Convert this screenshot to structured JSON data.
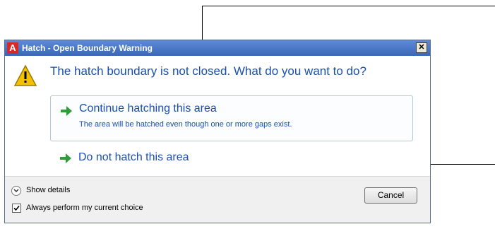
{
  "dialog": {
    "title": "Hatch - Open Boundary Warning",
    "app_icon_letter": "A",
    "close_glyph": "✕",
    "main_instruction": "The hatch boundary is not closed. What do you want to do?",
    "icons": {
      "warning": "warning-triangle-icon",
      "arrow": "green-arrow-icon"
    }
  },
  "choices": [
    {
      "label": "Continue hatching this area",
      "description": "The area will be hatched even though one or more gaps exist."
    },
    {
      "label": "Do not hatch this area"
    }
  ],
  "footer": {
    "details_label": "Show details",
    "checkbox_label": "Always perform my current choice",
    "checkbox_checked": true,
    "cancel_label": "Cancel"
  },
  "colors": {
    "accent_text": "#1a4fb0",
    "arrow": "#2e9d3a",
    "warning": "#f2c200"
  }
}
